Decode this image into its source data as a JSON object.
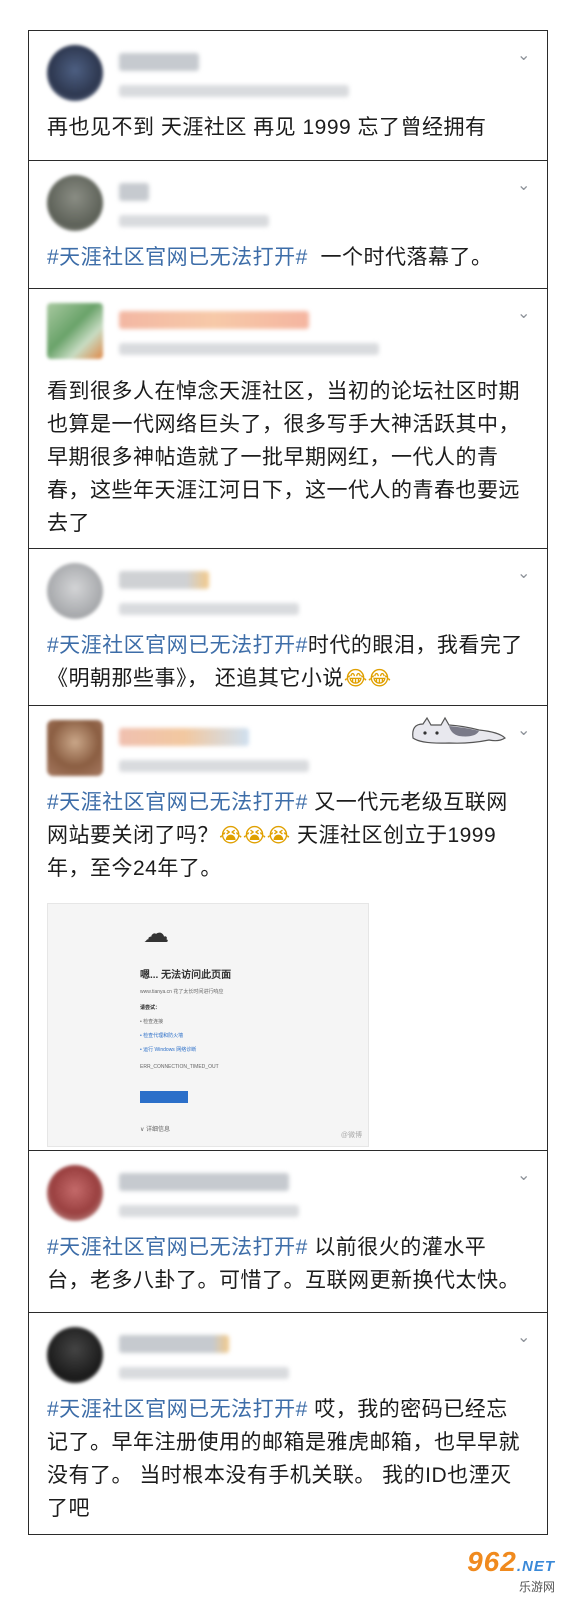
{
  "icons": {
    "collapse": "chevron-down-icon"
  },
  "posts": [
    {
      "avatar_color": "#3b4a6a",
      "name_color": "#c6cacf",
      "text": "再也见不到 天涯社区 再见 1999 忘了曾经拥有",
      "tag": ""
    },
    {
      "avatar_color": "#6d7167",
      "name_color": "#c6cacf",
      "tag": "#天涯社区官网已无法打开#",
      "text": "一个时代落幕了。"
    },
    {
      "avatar_color": "#86b384",
      "name_color": "#f0b8a4",
      "tag": "",
      "text": "看到很多人在悼念天涯社区，当初的论坛社区时期也算是一代网络巨头了，很多写手大神活跃其中，早期很多神帖造就了一批早期网红，一代人的青春，这些年天涯江河日下，这一代人的青春也要远去了"
    },
    {
      "avatar_color": "#b9bbbd",
      "name_color": "#cfd1d4",
      "tag": "#天涯社区官网已无法打开#",
      "text": "时代的眼泪，我看完了《明朝那些事》， 还追其它小说",
      "emoji": "😂😂"
    },
    {
      "avatar_color": "#c09a7a",
      "name_color": "#f0c0b0",
      "tag": "#天涯社区官网已无法打开#",
      "text": " 又一代元老级互联网网站要关闭了吗？",
      "emoji": "😭😭😭",
      "text2": " 天涯社区创立于1999年，至今24年了。"
    },
    {
      "avatar_color": "#b55a5a",
      "name_color": "#c6cacf",
      "tag": "#天涯社区官网已无法打开#",
      "text": " 以前很火的灌水平台，老多八卦了。可惜了。互联网更新换代太快。"
    },
    {
      "avatar_color": "#2a2a2a",
      "name_color": "#c6cacf",
      "tag": "#天涯社区官网已无法打开#",
      "text": " 哎，我的密码已经忘记了。早年注册使用的邮箱是雅虎邮箱，也早早就没有了。 当时根本没有手机关联。 我的ID也湮灭了吧"
    }
  ],
  "screenshot": {
    "title": "嗯... 无法访问此页面",
    "url_line": "www.tianya.cn 花了太长时间进行响应",
    "try": "请尝试：",
    "items": [
      "• 检查连接",
      "• 检查代理和防火墙",
      "• 运行 Windows 网络诊断"
    ],
    "error": "ERR_CONNECTION_TIMED_OUT",
    "details": "∨ 详细信息",
    "mark": "@微博"
  },
  "watermark": {
    "brand": "962",
    "suffix": ".NET",
    "site": "乐游网"
  }
}
